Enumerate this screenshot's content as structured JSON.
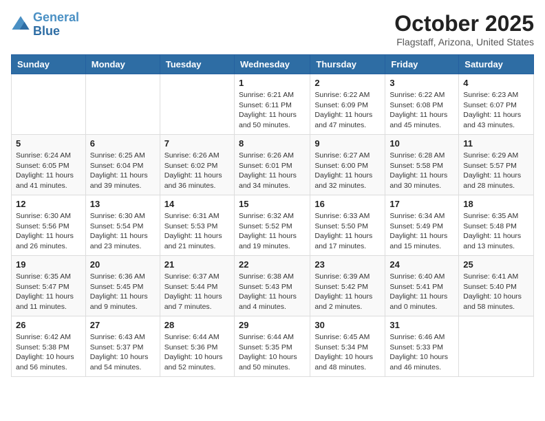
{
  "header": {
    "logo_line1": "General",
    "logo_line2": "Blue",
    "month_title": "October 2025",
    "location": "Flagstaff, Arizona, United States"
  },
  "weekdays": [
    "Sunday",
    "Monday",
    "Tuesday",
    "Wednesday",
    "Thursday",
    "Friday",
    "Saturday"
  ],
  "weeks": [
    [
      {
        "day": "",
        "info": ""
      },
      {
        "day": "",
        "info": ""
      },
      {
        "day": "",
        "info": ""
      },
      {
        "day": "1",
        "info": "Sunrise: 6:21 AM\nSunset: 6:11 PM\nDaylight: 11 hours\nand 50 minutes."
      },
      {
        "day": "2",
        "info": "Sunrise: 6:22 AM\nSunset: 6:09 PM\nDaylight: 11 hours\nand 47 minutes."
      },
      {
        "day": "3",
        "info": "Sunrise: 6:22 AM\nSunset: 6:08 PM\nDaylight: 11 hours\nand 45 minutes."
      },
      {
        "day": "4",
        "info": "Sunrise: 6:23 AM\nSunset: 6:07 PM\nDaylight: 11 hours\nand 43 minutes."
      }
    ],
    [
      {
        "day": "5",
        "info": "Sunrise: 6:24 AM\nSunset: 6:05 PM\nDaylight: 11 hours\nand 41 minutes."
      },
      {
        "day": "6",
        "info": "Sunrise: 6:25 AM\nSunset: 6:04 PM\nDaylight: 11 hours\nand 39 minutes."
      },
      {
        "day": "7",
        "info": "Sunrise: 6:26 AM\nSunset: 6:02 PM\nDaylight: 11 hours\nand 36 minutes."
      },
      {
        "day": "8",
        "info": "Sunrise: 6:26 AM\nSunset: 6:01 PM\nDaylight: 11 hours\nand 34 minutes."
      },
      {
        "day": "9",
        "info": "Sunrise: 6:27 AM\nSunset: 6:00 PM\nDaylight: 11 hours\nand 32 minutes."
      },
      {
        "day": "10",
        "info": "Sunrise: 6:28 AM\nSunset: 5:58 PM\nDaylight: 11 hours\nand 30 minutes."
      },
      {
        "day": "11",
        "info": "Sunrise: 6:29 AM\nSunset: 5:57 PM\nDaylight: 11 hours\nand 28 minutes."
      }
    ],
    [
      {
        "day": "12",
        "info": "Sunrise: 6:30 AM\nSunset: 5:56 PM\nDaylight: 11 hours\nand 26 minutes."
      },
      {
        "day": "13",
        "info": "Sunrise: 6:30 AM\nSunset: 5:54 PM\nDaylight: 11 hours\nand 23 minutes."
      },
      {
        "day": "14",
        "info": "Sunrise: 6:31 AM\nSunset: 5:53 PM\nDaylight: 11 hours\nand 21 minutes."
      },
      {
        "day": "15",
        "info": "Sunrise: 6:32 AM\nSunset: 5:52 PM\nDaylight: 11 hours\nand 19 minutes."
      },
      {
        "day": "16",
        "info": "Sunrise: 6:33 AM\nSunset: 5:50 PM\nDaylight: 11 hours\nand 17 minutes."
      },
      {
        "day": "17",
        "info": "Sunrise: 6:34 AM\nSunset: 5:49 PM\nDaylight: 11 hours\nand 15 minutes."
      },
      {
        "day": "18",
        "info": "Sunrise: 6:35 AM\nSunset: 5:48 PM\nDaylight: 11 hours\nand 13 minutes."
      }
    ],
    [
      {
        "day": "19",
        "info": "Sunrise: 6:35 AM\nSunset: 5:47 PM\nDaylight: 11 hours\nand 11 minutes."
      },
      {
        "day": "20",
        "info": "Sunrise: 6:36 AM\nSunset: 5:45 PM\nDaylight: 11 hours\nand 9 minutes."
      },
      {
        "day": "21",
        "info": "Sunrise: 6:37 AM\nSunset: 5:44 PM\nDaylight: 11 hours\nand 7 minutes."
      },
      {
        "day": "22",
        "info": "Sunrise: 6:38 AM\nSunset: 5:43 PM\nDaylight: 11 hours\nand 4 minutes."
      },
      {
        "day": "23",
        "info": "Sunrise: 6:39 AM\nSunset: 5:42 PM\nDaylight: 11 hours\nand 2 minutes."
      },
      {
        "day": "24",
        "info": "Sunrise: 6:40 AM\nSunset: 5:41 PM\nDaylight: 11 hours\nand 0 minutes."
      },
      {
        "day": "25",
        "info": "Sunrise: 6:41 AM\nSunset: 5:40 PM\nDaylight: 10 hours\nand 58 minutes."
      }
    ],
    [
      {
        "day": "26",
        "info": "Sunrise: 6:42 AM\nSunset: 5:38 PM\nDaylight: 10 hours\nand 56 minutes."
      },
      {
        "day": "27",
        "info": "Sunrise: 6:43 AM\nSunset: 5:37 PM\nDaylight: 10 hours\nand 54 minutes."
      },
      {
        "day": "28",
        "info": "Sunrise: 6:44 AM\nSunset: 5:36 PM\nDaylight: 10 hours\nand 52 minutes."
      },
      {
        "day": "29",
        "info": "Sunrise: 6:44 AM\nSunset: 5:35 PM\nDaylight: 10 hours\nand 50 minutes."
      },
      {
        "day": "30",
        "info": "Sunrise: 6:45 AM\nSunset: 5:34 PM\nDaylight: 10 hours\nand 48 minutes."
      },
      {
        "day": "31",
        "info": "Sunrise: 6:46 AM\nSunset: 5:33 PM\nDaylight: 10 hours\nand 46 minutes."
      },
      {
        "day": "",
        "info": ""
      }
    ]
  ]
}
